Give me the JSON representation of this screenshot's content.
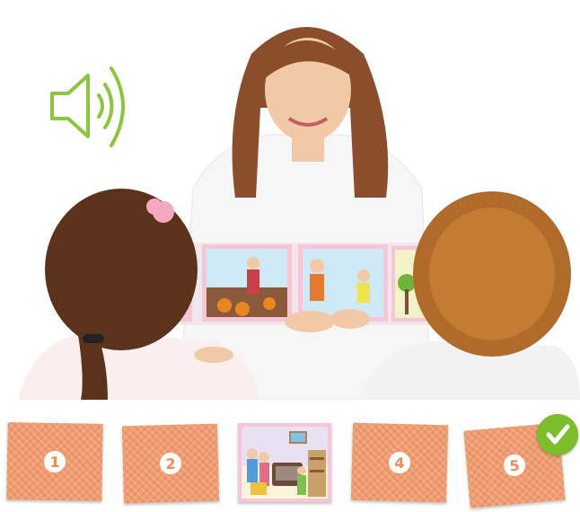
{
  "activity": {
    "speaker_icon": "speaker-icon",
    "accent_color": "#8cc63f",
    "card_color": "#ef9c70"
  },
  "cards": [
    {
      "label": "1"
    },
    {
      "label": "2"
    },
    {
      "label": "",
      "revealed": true
    },
    {
      "label": "4"
    },
    {
      "label": "5",
      "correct": true
    }
  ],
  "check_icon": "checkmark-icon"
}
